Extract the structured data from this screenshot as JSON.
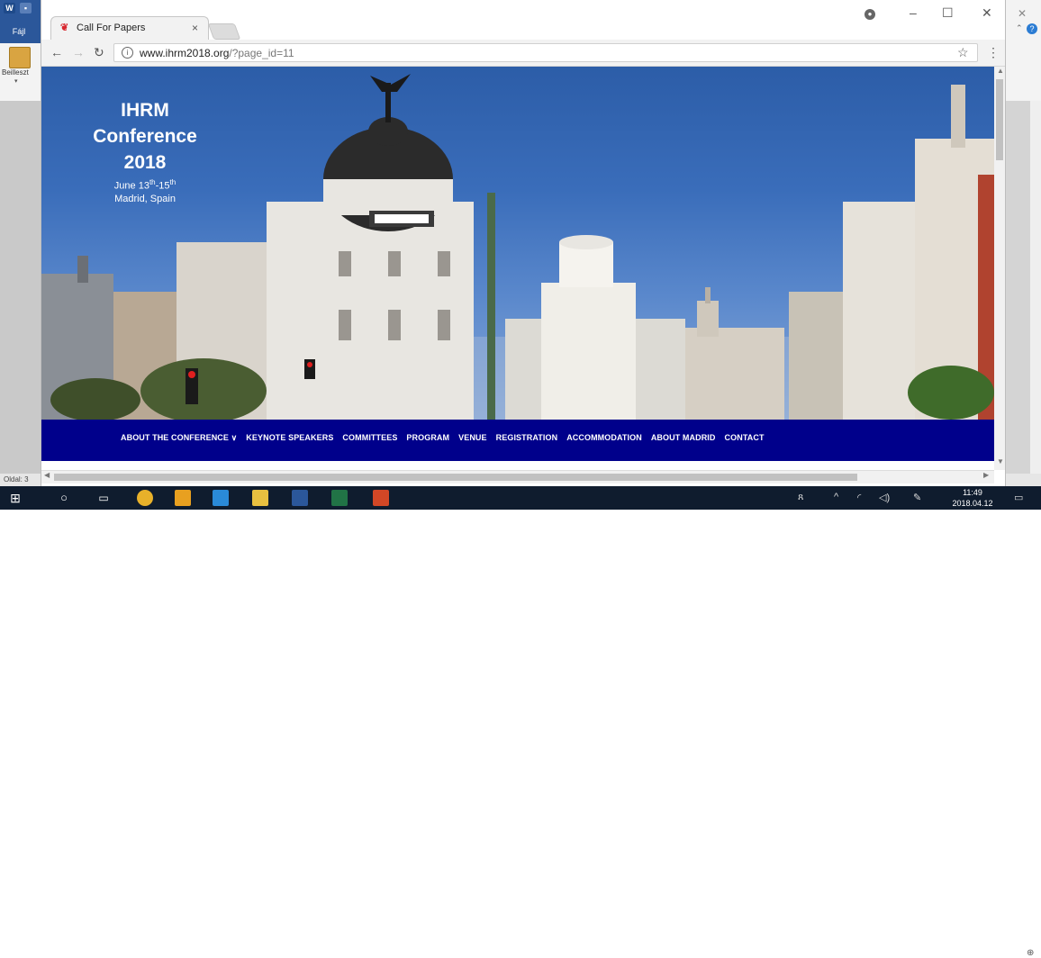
{
  "word": {
    "file_tab": "Fájl",
    "paste_label": "Beilleszt",
    "status_text": "Oldal: 3",
    "help_glyph": "?"
  },
  "browser": {
    "tab_title": "Call For Papers",
    "url_host": "www.ihrm2018.org",
    "url_path": "/?page_id=11"
  },
  "page": {
    "title_line1": "IHRM",
    "title_line2": "Conference",
    "title_line3": "2018",
    "date_text": "June 13",
    "date_sup1": "th",
    "date_sep": "-15",
    "date_sup2": "th",
    "place": "Madrid, Spain",
    "nav": [
      "ABOUT THE CONFERENCE ∨",
      "KEYNOTE SPEAKERS",
      "COMMITTEES",
      "PROGRAM",
      "VENUE",
      "REGISTRATION",
      "ACCOMMODATION",
      "ABOUT MADRID",
      "CONTACT"
    ]
  },
  "taskbar": {
    "time": "11:49",
    "date": "2018.04.12"
  },
  "colors": {
    "navbar": "#00008b",
    "sky": "#3a6dba",
    "word_blue": "#2b579a",
    "taskbar": "#0f1c2e"
  }
}
